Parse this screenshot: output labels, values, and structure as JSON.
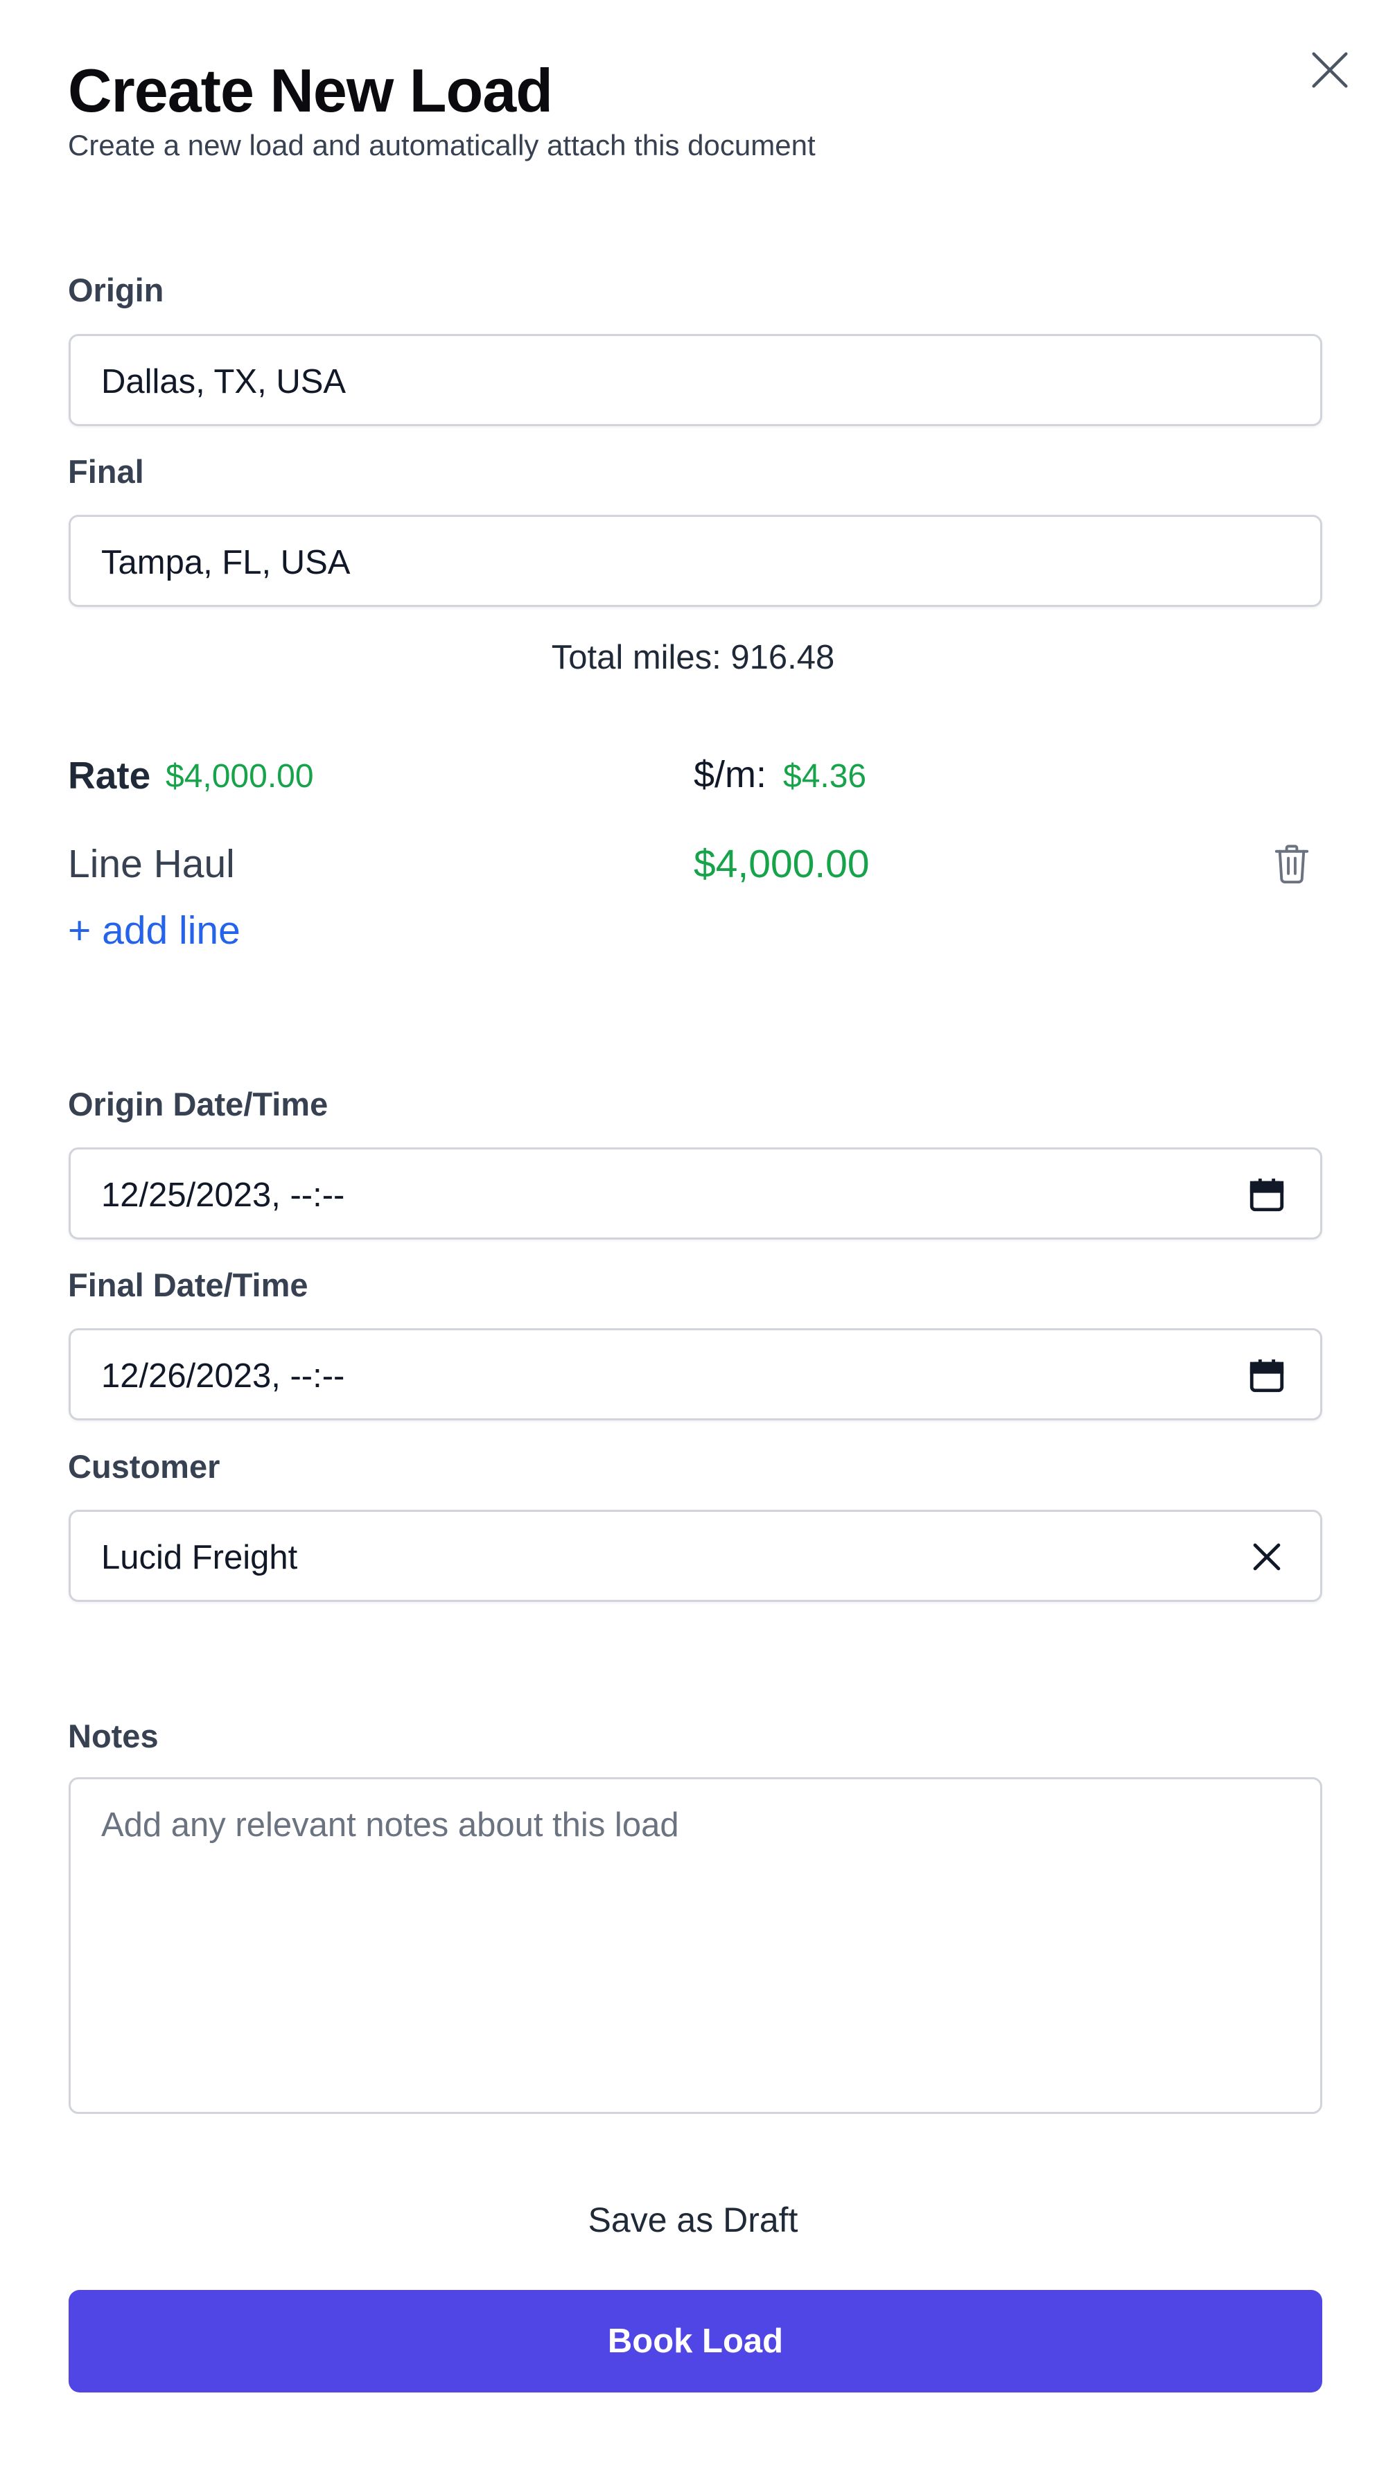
{
  "header": {
    "title": "Create New Load",
    "subtitle": "Create a new load and automatically attach this document"
  },
  "icons": {
    "close": "close-icon",
    "calendar": "calendar-icon",
    "clear": "clear-icon",
    "trash": "trash-icon"
  },
  "origin": {
    "label": "Origin",
    "value": "Dallas, TX, USA"
  },
  "final": {
    "label": "Final",
    "value": "Tampa, FL, USA"
  },
  "total_miles": "Total miles: 916.48",
  "rate": {
    "label": "Rate",
    "value": "$4,000.00",
    "per_mile_label": "$/m:",
    "per_mile_value": "$4.36",
    "accent_color": "#16a34a"
  },
  "line_items": [
    {
      "name": "Line Haul",
      "amount": "$4,000.00"
    }
  ],
  "add_line_label": "+ add line",
  "origin_datetime": {
    "label": "Origin Date/Time",
    "value": "12/25/2023, --:--"
  },
  "final_datetime": {
    "label": "Final Date/Time",
    "value": "12/26/2023, --:--"
  },
  "customer": {
    "label": "Customer",
    "value": "Lucid Freight"
  },
  "notes": {
    "label": "Notes",
    "placeholder": "Add any relevant notes about this load"
  },
  "actions": {
    "save_draft": "Save as Draft",
    "book": "Book Load",
    "book_color": "#4f46e5",
    "link_color": "#2563eb"
  }
}
